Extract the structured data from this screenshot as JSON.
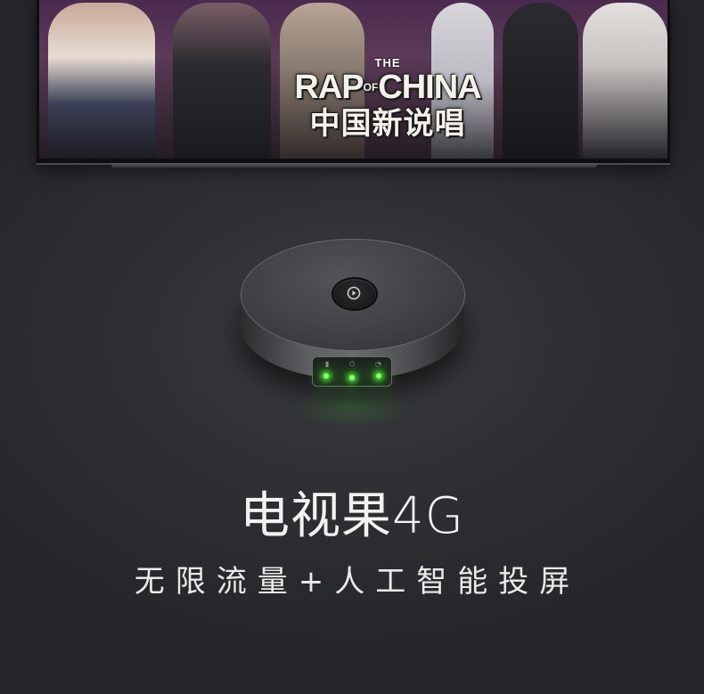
{
  "tv": {
    "logo_the": "THE",
    "logo_main": "RAP",
    "logo_of": "OF",
    "logo_main_2": "CHINA",
    "logo_chinese": "中国新说唱"
  },
  "product": {
    "title": "电视果4G",
    "subtitle": "无限流量+人工智能投屏"
  },
  "device": {
    "button_icon": "play-icon",
    "status_leds": [
      {
        "icon": "signal-icon",
        "color": "#8cff6a"
      },
      {
        "icon": "power-icon",
        "color": "#8cff6a"
      },
      {
        "icon": "wifi-icon",
        "color": "#8cff6a"
      }
    ]
  },
  "colors": {
    "background": "#2a2b2e",
    "led_green": "#8cff6a",
    "text": "#f2f2f2"
  }
}
